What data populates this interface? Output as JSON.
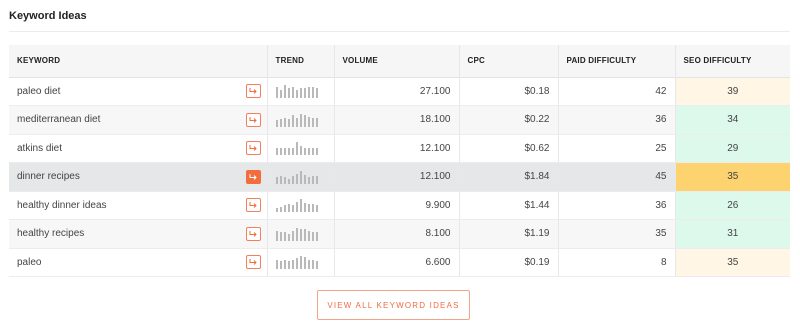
{
  "section_title": "Keyword Ideas",
  "columns": {
    "keyword": "KEYWORD",
    "trend": "TREND",
    "volume": "VOLUME",
    "cpc": "CPC",
    "paid_difficulty": "PAID DIFFICULTY",
    "seo_difficulty": "SEO DIFFICULTY"
  },
  "rows": [
    {
      "keyword": "paleo diet",
      "volume": "27.100",
      "cpc": "$0.18",
      "paid": "42",
      "seo": "39",
      "trend": [
        7,
        5,
        8,
        6,
        7,
        5,
        6,
        6,
        7,
        7,
        6
      ]
    },
    {
      "keyword": "mediterranean diet",
      "volume": "18.100",
      "cpc": "$0.22",
      "paid": "36",
      "seo": "34",
      "trend": [
        5,
        6,
        7,
        6,
        9,
        7,
        10,
        9,
        8,
        7,
        7
      ]
    },
    {
      "keyword": "atkins diet",
      "volume": "12.100",
      "cpc": "$0.62",
      "paid": "25",
      "seo": "29",
      "trend": [
        4,
        4,
        4,
        4,
        4,
        7,
        5,
        4,
        4,
        4,
        4
      ]
    },
    {
      "keyword": "dinner recipes",
      "volume": "12.100",
      "cpc": "$1.84",
      "paid": "45",
      "seo": "35",
      "trend": [
        6,
        7,
        6,
        5,
        7,
        9,
        12,
        8,
        6,
        7,
        7
      ]
    },
    {
      "keyword": "healthy dinner ideas",
      "volume": "9.900",
      "cpc": "$1.44",
      "paid": "36",
      "seo": "26",
      "trend": [
        4,
        5,
        6,
        7,
        6,
        9,
        12,
        8,
        7,
        7,
        6
      ]
    },
    {
      "keyword": "healthy recipes",
      "volume": "8.100",
      "cpc": "$1.19",
      "paid": "35",
      "seo": "31",
      "trend": [
        7,
        6,
        6,
        5,
        7,
        9,
        8,
        8,
        7,
        6,
        6
      ]
    },
    {
      "keyword": "paleo",
      "volume": "6.600",
      "cpc": "$0.19",
      "paid": "8",
      "seo": "35",
      "trend": [
        8,
        7,
        8,
        7,
        8,
        9,
        11,
        10,
        8,
        8,
        7
      ]
    }
  ],
  "view_all_label": "VIEW ALL KEYWORD IDEAS",
  "colors": {
    "accent": "#f26c3d",
    "seo_easy": "#dcf9ec",
    "seo_mid": "#fff6e6",
    "seo_hard": "#fdd36f"
  },
  "icons": {
    "keyword_action": "arrow-turn-right-icon"
  }
}
